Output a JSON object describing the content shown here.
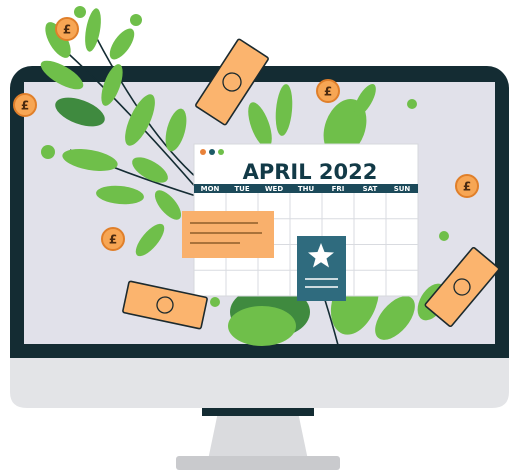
{
  "calendar": {
    "title": "APRIL 2022",
    "weekdays": [
      "MON",
      "TUE",
      "WED",
      "THU",
      "FRI",
      "SAT",
      "SUN"
    ],
    "window_dots": [
      "#e8823a",
      "#1c5a66",
      "#6fbf4a"
    ]
  },
  "currency_symbol": "£",
  "colors": {
    "monitor_frame": "#142c33",
    "screen_bg": "#e1e1ea",
    "stand": "#dadbde",
    "leaf_light": "#6fbf4a",
    "leaf_dark": "#3f8a3f",
    "money": "#fbb46e",
    "money_outline": "#1c2a2e",
    "calendar_header": "#1c4a5a",
    "note_orange": "#f9b06c",
    "note_blue": "#2f6b7e"
  }
}
